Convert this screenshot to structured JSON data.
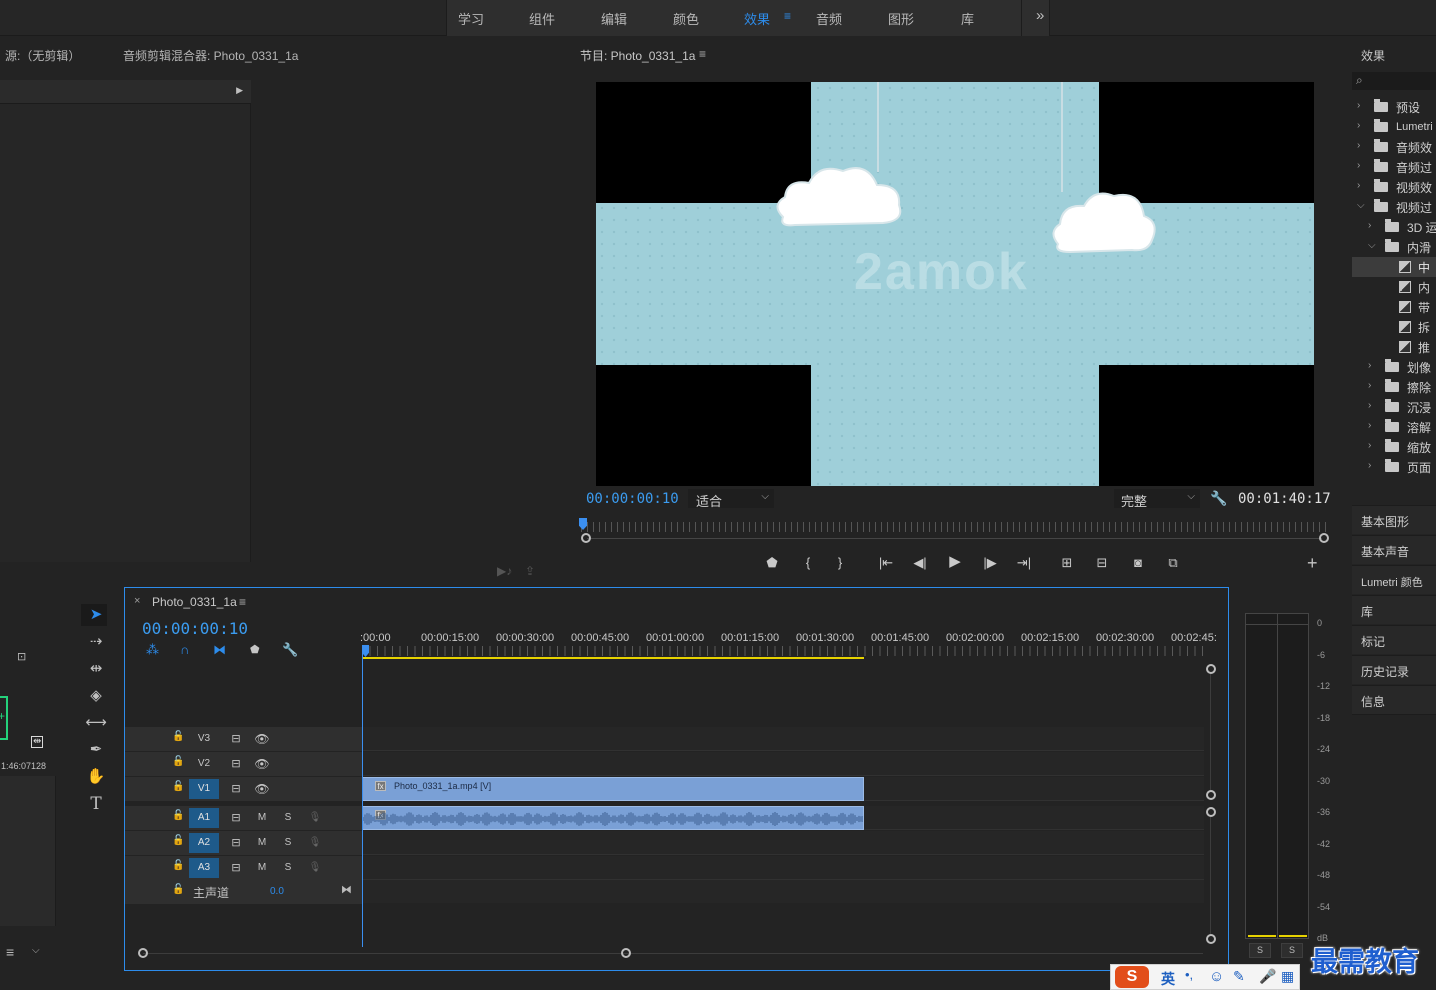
{
  "workspaces": {
    "items": [
      "学习",
      "组件",
      "编辑",
      "颜色",
      "效果",
      "音频",
      "图形",
      "库"
    ],
    "active_index": 4,
    "more": "»"
  },
  "source_panel": {
    "source_tab": "源:（无剪辑）",
    "mixer_tab": "音频剪辑混合器: Photo_0331_1a"
  },
  "program": {
    "title": "节目: Photo_0331_1a",
    "menu": "≡",
    "timecode": "00:00:00:10",
    "fit_label": "适合",
    "quality_label": "完整",
    "duration": "00:01:40:17",
    "watermark": "2amok",
    "add": "+"
  },
  "timeline": {
    "tab_close": "×",
    "sequence_name": "Photo_0331_1a",
    "menu": "≡",
    "timecode": "00:00:00:10",
    "ruler_labels": [
      ":00:00",
      "00:00:15:00",
      "00:00:30:00",
      "00:00:45:00",
      "00:01:00:00",
      "00:01:15:00",
      "00:01:30:00",
      "00:01:45:00",
      "00:02:00:00",
      "00:02:15:00",
      "00:02:30:00",
      "00:02:45:"
    ],
    "video_tracks": [
      "V3",
      "V2",
      "V1"
    ],
    "audio_tracks": [
      "A1",
      "A2",
      "A3"
    ],
    "mute": "M",
    "solo": "S",
    "master_label": "主声道",
    "master_value": "0.0",
    "video_clip": "Photo_0331_1a.mp4 [V]",
    "clip_end_fraction": 0.596
  },
  "project_panel": {
    "time_text": "1:46:07128"
  },
  "effects_panel": {
    "title": "效果",
    "search_icon": "search-icon",
    "items": [
      {
        "label": "预设",
        "level": 0,
        "open": false,
        "kind": "preset"
      },
      {
        "label": "Lumetri",
        "level": 0,
        "open": false,
        "kind": "preset"
      },
      {
        "label": "音频效",
        "level": 0,
        "open": false,
        "kind": "folder"
      },
      {
        "label": "音频过",
        "level": 0,
        "open": false,
        "kind": "folder"
      },
      {
        "label": "视频效",
        "level": 0,
        "open": false,
        "kind": "folder"
      },
      {
        "label": "视频过",
        "level": 0,
        "open": true,
        "kind": "folder"
      },
      {
        "label": "3D 运",
        "level": 1,
        "open": false,
        "kind": "folder"
      },
      {
        "label": "内滑",
        "level": 1,
        "open": true,
        "kind": "folder"
      },
      {
        "label": "中",
        "level": 2,
        "kind": "transition",
        "selected": true
      },
      {
        "label": "内",
        "level": 2,
        "kind": "transition"
      },
      {
        "label": "带",
        "level": 2,
        "kind": "transition"
      },
      {
        "label": "拆",
        "level": 2,
        "kind": "transition"
      },
      {
        "label": "推",
        "level": 2,
        "kind": "transition"
      },
      {
        "label": "划像",
        "level": 1,
        "open": false,
        "kind": "folder"
      },
      {
        "label": "擦除",
        "level": 1,
        "open": false,
        "kind": "folder"
      },
      {
        "label": "沉浸",
        "level": 1,
        "open": false,
        "kind": "folder"
      },
      {
        "label": "溶解",
        "level": 1,
        "open": false,
        "kind": "folder"
      },
      {
        "label": "缩放",
        "level": 1,
        "open": false,
        "kind": "folder"
      },
      {
        "label": "页面",
        "level": 1,
        "open": false,
        "kind": "folder"
      }
    ],
    "side_panels": [
      "基本图形",
      "基本声音",
      "Lumetri 颜色",
      "库",
      "标记",
      "历史记录",
      "信息"
    ]
  },
  "meter": {
    "labels": [
      "0",
      "-6",
      "-12",
      "-18",
      "-24",
      "-30",
      "-36",
      "-42",
      "-48",
      "-54",
      "dB"
    ],
    "solo_left": "S",
    "solo_right": "S"
  },
  "ime": {
    "lang": "英",
    "punct": "•,"
  },
  "brand": {
    "text": "最需教育"
  },
  "colors": {
    "accent": "#2d8ceb",
    "timecode": "#3b9cf0",
    "clip_video": "#7aa0d6",
    "clip_audio": "#7aa0d6",
    "work_area": "#e6d200",
    "brand_text": "#1f5fcf",
    "sky": "#9fcfd9"
  }
}
